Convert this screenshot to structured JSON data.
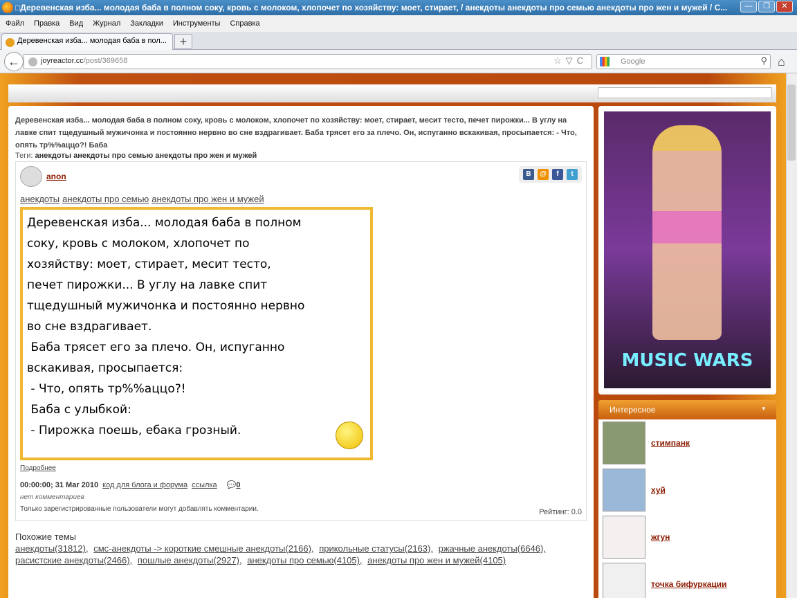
{
  "window": {
    "title": "□Деревенская изба... молодая баба в полном соку, кровь с молоком, хлопочет по хозяйству: моет, стирает, / анекдоты анекдоты про семью анекдоты про жен и мужей / С...",
    "min": "—",
    "max": "❐",
    "close": "✕"
  },
  "menu": [
    "Файл",
    "Правка",
    "Вид",
    "Журнал",
    "Закладки",
    "Инструменты",
    "Справка"
  ],
  "tab": {
    "label": "Деревенская изба... молодая баба в пол...",
    "new": "+"
  },
  "nav": {
    "url_host": "joyreactor.cc",
    "url_path": "/post/369658",
    "search_placeholder": "Google",
    "back": "←",
    "home": "⌂",
    "url_icons": "☆▽C",
    "search_icon": "⚲"
  },
  "post": {
    "intro": "Деревенская изба... молодая баба в полном соку, кровь с молоком, хлопочет по хозяйству: моет, стирает, месит тесто, печет пирожки... В углу на лавке спит тщедушный мужичонка и постоянно нервно во сне вздрагивает. Баба трясет его за плечо. Он, испуганно вскакивая, просыпается: - Что, опять тр%%аццо?! Баба",
    "tags_label": "Теги:",
    "tags_text": "анекдоты анекдоты про семью анекдоты про жен и мужей",
    "author": "anon",
    "share": [
      "B",
      "@",
      "f",
      "t"
    ],
    "links": [
      "анекдоты",
      "анекдоты про семью",
      "анекдоты про жен и мужей"
    ],
    "image_text": "Деревенская изба... молодая баба в полном\nсоку, кровь с молоком, хлопочет по\nхозяйству: моет, стирает, месит тесто,\nпечет пирожки... В углу на лавке спит\nтщедушный мужичонка и постоянно нервно\nво сне вздрагивает.\n Баба трясет его за плечо. Он, испуганно\nвскакивая, просыпается:\n - Что, опять тр%%аццо?!\n Баба с улыбкой:\n - Пирожка поешь, ебака грозный.",
    "more": "Подробнее",
    "datetime": "00:00:00; 31 Mar 2010",
    "code_link": "код для блога и форума",
    "link": "ссылка",
    "comments_count": "0",
    "no_comments": "нет комментариев",
    "reg_only": "Только зарегистрированные пользователи могут добавлять комментарии.",
    "rating": "Рейтинг: 0.0"
  },
  "related": {
    "title": "Похожие темы",
    "items": [
      "анекдоты(31812),",
      "смс-анекдоты -> короткие смешные анекдоты(2166),",
      "прикольные статусы(2163),",
      "ржачные анекдоты(6646),",
      "расистские анекдоты(2466),",
      "пошлые анекдоты(2927),",
      "анекдоты про семью(4105),",
      "анекдоты про жен и мужей(4105)"
    ]
  },
  "ad": {
    "logo": "MUSIC WARS"
  },
  "interesting": {
    "title": "Интересное",
    "items": [
      "стимпанк",
      "хуй",
      "жгун",
      "точка бифуркации"
    ]
  }
}
